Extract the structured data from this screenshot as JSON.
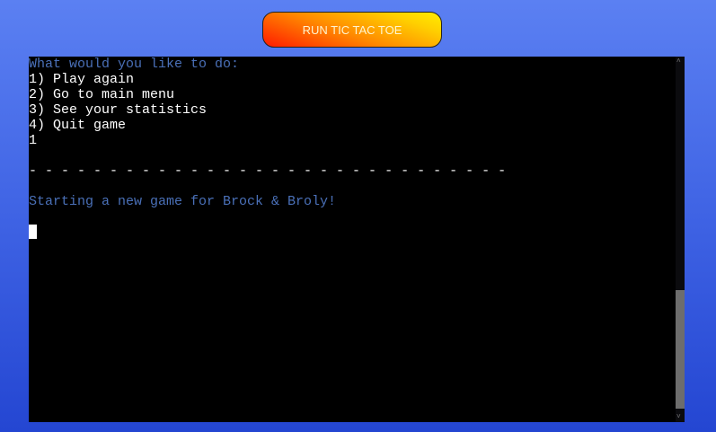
{
  "header": {
    "run_button_label": "RUN TIC TAC TOE"
  },
  "terminal": {
    "lines": [
      {
        "text": "What would you like to do:",
        "color": "blue"
      },
      {
        "text": "1) Play again",
        "color": "white"
      },
      {
        "text": "2) Go to main menu",
        "color": "white"
      },
      {
        "text": "3) See your statistics",
        "color": "white"
      },
      {
        "text": "4) Quit game",
        "color": "white"
      },
      {
        "text": "1",
        "color": "white"
      },
      {
        "text": "",
        "color": "white"
      },
      {
        "text": "- - - - - - - - - - - - - - - - - - - - - - - - - - - - - -",
        "color": "white"
      },
      {
        "text": "",
        "color": "white"
      },
      {
        "text": "Starting a new game for Brock & Broly!",
        "color": "blue"
      },
      {
        "text": "",
        "color": "white"
      }
    ],
    "colors": {
      "prompt_blue": "#4a70b8",
      "text": "#ffffff",
      "background": "#000000"
    },
    "scroll_position_percent": 100
  }
}
